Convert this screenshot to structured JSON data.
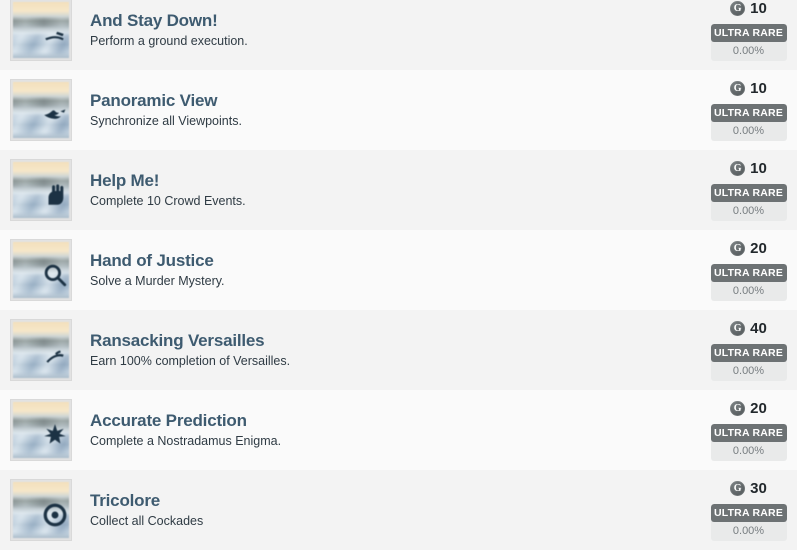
{
  "list": {
    "rows": [
      {
        "title": "And Stay Down!",
        "description": "Perform a ground execution.",
        "points": "10",
        "points_icon_letter": "G",
        "rarity_label": "ULTRA RARE",
        "rarity_percent": "0.00%",
        "thumb_icon": "ground-execution-icon"
      },
      {
        "title": "Panoramic View",
        "description": "Synchronize all Viewpoints.",
        "points": "10",
        "points_icon_letter": "G",
        "rarity_label": "ULTRA RARE",
        "rarity_percent": "0.00%",
        "thumb_icon": "eagle-icon"
      },
      {
        "title": "Help Me!",
        "description": "Complete 10 Crowd Events.",
        "points": "10",
        "points_icon_letter": "G",
        "rarity_label": "ULTRA RARE",
        "rarity_percent": "0.00%",
        "thumb_icon": "helping-hand-icon"
      },
      {
        "title": "Hand of Justice",
        "description": "Solve a Murder Mystery.",
        "points": "20",
        "points_icon_letter": "G",
        "rarity_label": "ULTRA RARE",
        "rarity_percent": "0.00%",
        "thumb_icon": "magnifying-glass-icon"
      },
      {
        "title": "Ransacking Versailles",
        "description": "Earn 100% completion of Versailles.",
        "points": "40",
        "points_icon_letter": "G",
        "rarity_label": "ULTRA RARE",
        "rarity_percent": "0.00%",
        "thumb_icon": "palace-icon"
      },
      {
        "title": "Accurate Prediction",
        "description": "Complete a Nostradamus Enigma.",
        "points": "20",
        "points_icon_letter": "G",
        "rarity_label": "ULTRA RARE",
        "rarity_percent": "0.00%",
        "thumb_icon": "star-burst-icon"
      },
      {
        "title": "Tricolore",
        "description": "Collect all Cockades",
        "points": "30",
        "points_icon_letter": "G",
        "rarity_label": "ULTRA RARE",
        "rarity_percent": "0.00%",
        "thumb_icon": "cockade-icon"
      }
    ]
  },
  "colors": {
    "title": "#3e5b70",
    "description": "#2f3b44",
    "points_value": "#22282c",
    "rarity_badge_bg": "#6d7274",
    "rarity_box_bg": "#e9eaea",
    "row_bg_odd": "#f3f3f3",
    "row_bg_even": "#fafafa"
  }
}
